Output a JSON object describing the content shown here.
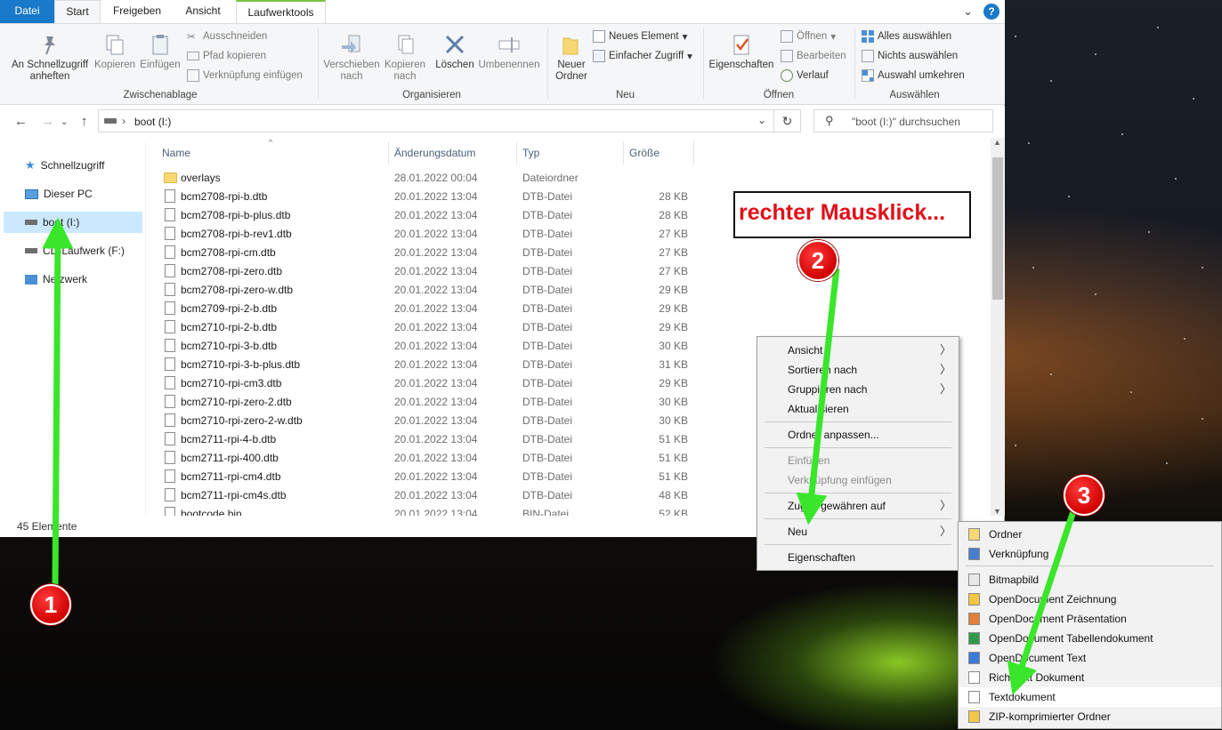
{
  "ribbon_tabs": [
    "Datei",
    "Start",
    "Freigeben",
    "Ansicht",
    "Laufwerktools"
  ],
  "ribbon": {
    "clipboard": {
      "pin_label": "An Schnellzugriff anheften",
      "copy_label": "Kopieren",
      "paste_label": "Einfügen",
      "cut_label": "Ausschneiden",
      "copy_path_label": "Pfad kopieren",
      "paste_shortcut_label": "Verknüpfung einfügen",
      "group_label": "Zwischenablage"
    },
    "organize": {
      "move_label": "Verschieben nach",
      "copy_to_label": "Kopieren nach",
      "delete_label": "Löschen",
      "rename_label": "Umbenennen",
      "group_label": "Organisieren"
    },
    "new": {
      "new_folder_label": "Neuer Ordner",
      "new_item_label": "Neues Element",
      "easy_access_label": "Einfacher Zugriff",
      "group_label": "Neu"
    },
    "open": {
      "properties_label": "Eigenschaften",
      "open_label": "Öffnen",
      "edit_label": "Bearbeiten",
      "history_label": "Verlauf",
      "group_label": "Öffnen"
    },
    "select": {
      "select_all_label": "Alles auswählen",
      "select_none_label": "Nichts auswählen",
      "invert_label": "Auswahl umkehren",
      "group_label": "Auswählen"
    }
  },
  "address": {
    "path": "boot (I:)",
    "search_placeholder": "\"boot (I:)\" durchsuchen"
  },
  "nav_pane": [
    "Schnellzugriff",
    "Dieser PC",
    "boot (I:)",
    "CD-Laufwerk (F:)",
    "Netzwerk"
  ],
  "columns": [
    "Name",
    "Änderungsdatum",
    "Typ",
    "Größe"
  ],
  "files": [
    {
      "name": "overlays",
      "date": "28.01.2022 00:04",
      "type": "Dateiordner",
      "size": ""
    },
    {
      "name": "bcm2708-rpi-b.dtb",
      "date": "20.01.2022 13:04",
      "type": "DTB-Datei",
      "size": "28 KB"
    },
    {
      "name": "bcm2708-rpi-b-plus.dtb",
      "date": "20.01.2022 13:04",
      "type": "DTB-Datei",
      "size": "28 KB"
    },
    {
      "name": "bcm2708-rpi-b-rev1.dtb",
      "date": "20.01.2022 13:04",
      "type": "DTB-Datei",
      "size": "27 KB"
    },
    {
      "name": "bcm2708-rpi-cm.dtb",
      "date": "20.01.2022 13:04",
      "type": "DTB-Datei",
      "size": "27 KB"
    },
    {
      "name": "bcm2708-rpi-zero.dtb",
      "date": "20.01.2022 13:04",
      "type": "DTB-Datei",
      "size": "27 KB"
    },
    {
      "name": "bcm2708-rpi-zero-w.dtb",
      "date": "20.01.2022 13:04",
      "type": "DTB-Datei",
      "size": "29 KB"
    },
    {
      "name": "bcm2709-rpi-2-b.dtb",
      "date": "20.01.2022 13:04",
      "type": "DTB-Datei",
      "size": "29 KB"
    },
    {
      "name": "bcm2710-rpi-2-b.dtb",
      "date": "20.01.2022 13:04",
      "type": "DTB-Datei",
      "size": "29 KB"
    },
    {
      "name": "bcm2710-rpi-3-b.dtb",
      "date": "20.01.2022 13:04",
      "type": "DTB-Datei",
      "size": "30 KB"
    },
    {
      "name": "bcm2710-rpi-3-b-plus.dtb",
      "date": "20.01.2022 13:04",
      "type": "DTB-Datei",
      "size": "31 KB"
    },
    {
      "name": "bcm2710-rpi-cm3.dtb",
      "date": "20.01.2022 13:04",
      "type": "DTB-Datei",
      "size": "29 KB"
    },
    {
      "name": "bcm2710-rpi-zero-2.dtb",
      "date": "20.01.2022 13:04",
      "type": "DTB-Datei",
      "size": "30 KB"
    },
    {
      "name": "bcm2710-rpi-zero-2-w.dtb",
      "date": "20.01.2022 13:04",
      "type": "DTB-Datei",
      "size": "30 KB"
    },
    {
      "name": "bcm2711-rpi-4-b.dtb",
      "date": "20.01.2022 13:04",
      "type": "DTB-Datei",
      "size": "51 KB"
    },
    {
      "name": "bcm2711-rpi-400.dtb",
      "date": "20.01.2022 13:04",
      "type": "DTB-Datei",
      "size": "51 KB"
    },
    {
      "name": "bcm2711-rpi-cm4.dtb",
      "date": "20.01.2022 13:04",
      "type": "DTB-Datei",
      "size": "51 KB"
    },
    {
      "name": "bcm2711-rpi-cm4s.dtb",
      "date": "20.01.2022 13:04",
      "type": "DTB-Datei",
      "size": "48 KB"
    },
    {
      "name": "bootcode.bin",
      "date": "20.01.2022 13:04",
      "type": "BIN-Datei",
      "size": "52 KB"
    }
  ],
  "status": "45 Elemente",
  "context_menu": [
    {
      "label": "Ansicht",
      "sub": true,
      "disabled": false
    },
    {
      "label": "Sortieren nach",
      "sub": true,
      "disabled": false
    },
    {
      "label": "Gruppieren nach",
      "sub": true,
      "disabled": false
    },
    {
      "label": "Aktualisieren",
      "sub": false,
      "disabled": false
    },
    {
      "label": "Ordner anpassen...",
      "sub": false,
      "disabled": false
    },
    {
      "label": "Einfügen",
      "sub": false,
      "disabled": true
    },
    {
      "label": "Verknüpfung einfügen",
      "sub": false,
      "disabled": true
    },
    {
      "label": "Zugriff gewähren auf",
      "sub": true,
      "disabled": false
    },
    {
      "label": "Neu",
      "sub": true,
      "disabled": false
    },
    {
      "label": "Eigenschaften",
      "sub": false,
      "disabled": false
    }
  ],
  "submenu_new": [
    {
      "label": "Ordner",
      "icon": "folder-icon"
    },
    {
      "label": "Verknüpfung",
      "icon": "shortcut-icon"
    },
    {
      "label": "Bitmapbild",
      "icon": "bitmap-icon"
    },
    {
      "label": "OpenDocument Zeichnung",
      "icon": "odg-icon"
    },
    {
      "label": "OpenDocument Präsentation",
      "icon": "odp-icon"
    },
    {
      "label": "OpenDocument Tabellendokument",
      "icon": "ods-icon"
    },
    {
      "label": "OpenDocument Text",
      "icon": "odt-icon"
    },
    {
      "label": "Rich Text Dokument",
      "icon": "rtf-icon"
    },
    {
      "label": "Textdokument",
      "icon": "text-document-icon"
    },
    {
      "label": "ZIP-komprimierter Ordner",
      "icon": "zip-folder-icon"
    }
  ],
  "annotations": {
    "callout_text": "rechter Mausklick...",
    "step1": "1",
    "step2": "2",
    "step3": "3"
  },
  "colors": {
    "accent": "#1979ca",
    "selection": "#cce8ff",
    "annotation_arrow": "#39e62a",
    "annotation_badge": "#e00000",
    "callout_text": "#e0101a"
  }
}
